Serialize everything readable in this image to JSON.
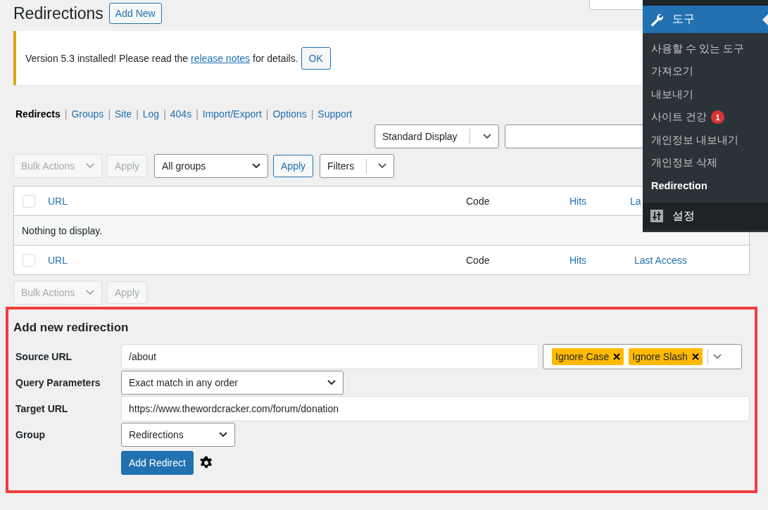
{
  "page": {
    "title": "Redirections",
    "add_new": "Add New"
  },
  "notice": {
    "before": "Version 5.3 installed! Please read the ",
    "link": "release notes",
    "after": " for details.",
    "button": "OK"
  },
  "subnav": [
    {
      "label": "Redirects",
      "selected": true
    },
    {
      "sep": "|",
      "label": "Groups",
      "selected": false
    },
    {
      "sep": "|",
      "label": "Site",
      "selected": false
    },
    {
      "sep": "|",
      "label": "Log",
      "selected": false
    },
    {
      "sep": "|",
      "label": "404s",
      "selected": false
    },
    {
      "sep": "|",
      "label": "Import/Export",
      "selected": false
    },
    {
      "sep": "|",
      "label": "Options",
      "selected": false
    },
    {
      "sep": "|",
      "label": "Support",
      "selected": false
    }
  ],
  "display_select": "Standard Display",
  "toolbar_top": {
    "bulk": "Bulk Actions",
    "bulk_apply": "Apply",
    "group_select": "All groups",
    "group_apply": "Apply",
    "filters": "Filters"
  },
  "table": {
    "header_checked": false,
    "footer_checked": false,
    "header": [
      {
        "label": "URL",
        "kind": "link"
      },
      {
        "label": "Code",
        "kind": "text"
      },
      {
        "label": "Hits",
        "kind": "link"
      },
      {
        "label": "La",
        "kind": "link"
      }
    ],
    "empty": "Nothing to display.",
    "footer": [
      {
        "label": "URL",
        "kind": "link"
      },
      {
        "label": "Code",
        "kind": "text"
      },
      {
        "label": "Hits",
        "kind": "link"
      },
      {
        "label": "Last Access",
        "kind": "link"
      }
    ]
  },
  "toolbar_bottom": {
    "bulk": "Bulk Actions",
    "bulk_apply": "Apply"
  },
  "form": {
    "title": "Add new redirection",
    "source_label": "Source URL",
    "source_value": "/about",
    "flags": [
      "Ignore Case",
      "Ignore Slash"
    ],
    "query_label": "Query Parameters",
    "query_value": "Exact match in any order",
    "target_label": "Target URL",
    "target_value": "https://www.thewordcracker.com/forum/donation",
    "group_label": "Group",
    "group_value": "Redirections",
    "submit": "Add Redirect"
  },
  "menu": {
    "header": "도구",
    "items": [
      {
        "label": "사용할 수 있는 도구",
        "selected": false
      },
      {
        "label": "가져오기",
        "selected": false
      },
      {
        "label": "내보내기",
        "selected": false
      },
      {
        "label": "사이트 건강",
        "selected": false,
        "badge": "1"
      },
      {
        "label": "개인정보 내보내기",
        "selected": false
      },
      {
        "label": "개인정보 삭제",
        "selected": false
      },
      {
        "label": "Redirection",
        "selected": true
      }
    ],
    "next": "설정"
  }
}
